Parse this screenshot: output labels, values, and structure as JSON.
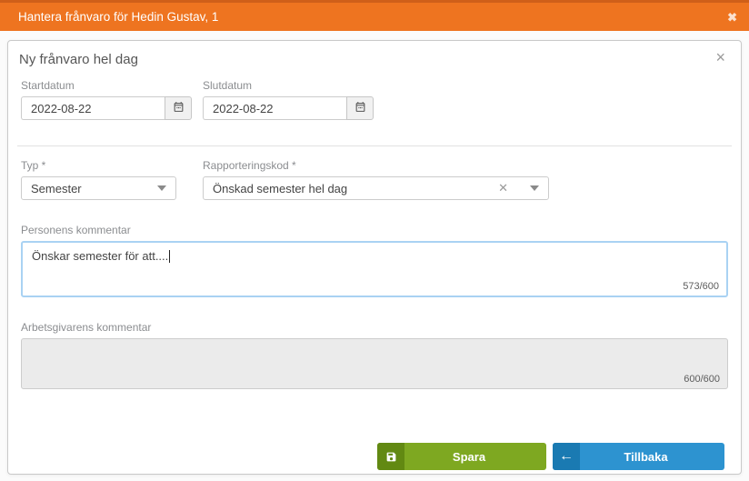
{
  "dialog": {
    "title": "Hantera frånvaro för Hedin Gustav, 1",
    "close_glyph": "✖"
  },
  "panel": {
    "title": "Ny frånvaro hel dag",
    "close_glyph": "×"
  },
  "fields": {
    "startdatum": {
      "label": "Startdatum",
      "value": "2022-08-22"
    },
    "slutdatum": {
      "label": "Slutdatum",
      "value": "2022-08-22"
    },
    "typ": {
      "label": "Typ *",
      "value": "Semester"
    },
    "rapporteringskod": {
      "label": "Rapporteringskod *",
      "value": "Önskad semester hel dag",
      "clear_glyph": "✕"
    },
    "personens_kommentar": {
      "label": "Personens kommentar",
      "value": "Önskar semester för att....",
      "counter": "573/600"
    },
    "arbetsgivarens_kommentar": {
      "label": "Arbetsgivarens kommentar",
      "value": "",
      "counter": "600/600"
    }
  },
  "buttons": {
    "spara": {
      "label": "Spara"
    },
    "tillbaka": {
      "label": "Tillbaka",
      "arrow_glyph": "←"
    }
  },
  "colors": {
    "accent_orange": "#ee7420",
    "accent_orange_dark": "#cf5f19",
    "save_green": "#7ea821",
    "save_green_dark": "#628912",
    "back_blue": "#2d93d0",
    "back_blue_dark": "#1a7ab2",
    "focus_border_blue": "#a9d2f3",
    "disabled_gray": "#ebebeb"
  }
}
